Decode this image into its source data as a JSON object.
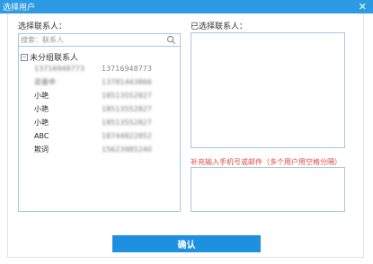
{
  "window": {
    "title": "选择用户",
    "close": "✕"
  },
  "left": {
    "label": "选择联系人：",
    "search_placeholder": "搜索：联系人",
    "group": {
      "toggle": "−",
      "label": "未分组联系人"
    },
    "contacts": [
      {
        "name": "13716948773",
        "phone": "13716948773"
      },
      {
        "name": "梁番申",
        "phone": "13781443866"
      },
      {
        "name": "小艳",
        "phone": "18513552827"
      },
      {
        "name": "小艳",
        "phone": "18513552827"
      },
      {
        "name": "小艳",
        "phone": "18513552827"
      },
      {
        "name": "ABC",
        "phone": "18744822852"
      },
      {
        "name": "欺词",
        "phone": "15623985240"
      }
    ]
  },
  "right": {
    "label": "已选择联系人：",
    "hint": "补充输入手机号或邮件（多个用户用空格分隔）"
  },
  "footer": {
    "confirm": "确认"
  }
}
